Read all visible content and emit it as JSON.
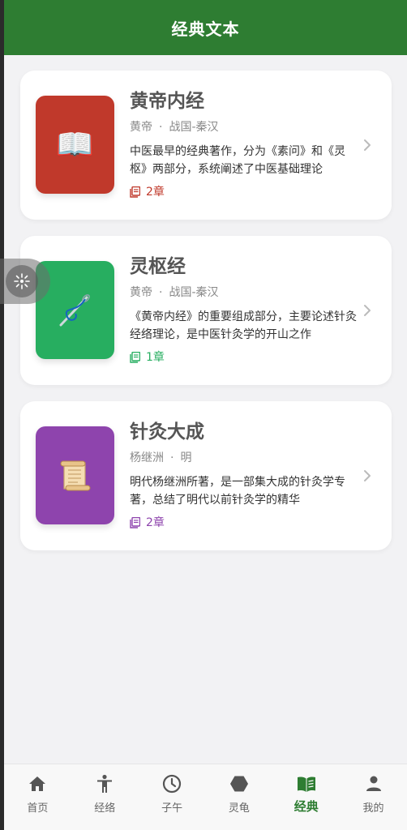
{
  "header": {
    "title": "经典文本"
  },
  "books": [
    {
      "title": "黄帝内经",
      "author": "黄帝",
      "dot": "·",
      "era": "战国-秦汉",
      "description": "中医最早的经典著作，分为《素问》和《灵枢》两部分，系统阐述了中医基础理论",
      "chapters": "2章",
      "cover_color": "#c0392b",
      "accent": "#c0392b",
      "icon": "open-book-icon",
      "glyph": "📖"
    },
    {
      "title": "灵枢经",
      "author": "黄帝",
      "dot": "·",
      "era": "战国-秦汉",
      "description": "《黄帝内经》的重要组成部分，主要论述针灸经络理论，是中医针灸学的开山之作",
      "chapters": "1章",
      "cover_color": "#27ae60",
      "accent": "#27ae60",
      "icon": "needle-icon",
      "glyph": "🪡"
    },
    {
      "title": "针灸大成",
      "author": "杨继洲",
      "dot": "·",
      "era": "明",
      "description": "明代杨继洲所著，是一部集大成的针灸学专著，总结了明代以前针灸学的精华",
      "chapters": "2章",
      "cover_color": "#8e44ad",
      "accent": "#8e44ad",
      "icon": "scroll-icon",
      "glyph": "📜"
    }
  ],
  "tabs": [
    {
      "label": "首页",
      "icon": "home-icon"
    },
    {
      "label": "经络",
      "icon": "body-icon"
    },
    {
      "label": "子午",
      "icon": "clock-icon"
    },
    {
      "label": "灵龟",
      "icon": "hexagon-icon"
    },
    {
      "label": "经典",
      "icon": "book-icon",
      "active": true
    },
    {
      "label": "我的",
      "icon": "person-icon"
    }
  ],
  "colors": {
    "primary": "#2e7d32",
    "background": "#f2f2f4"
  }
}
